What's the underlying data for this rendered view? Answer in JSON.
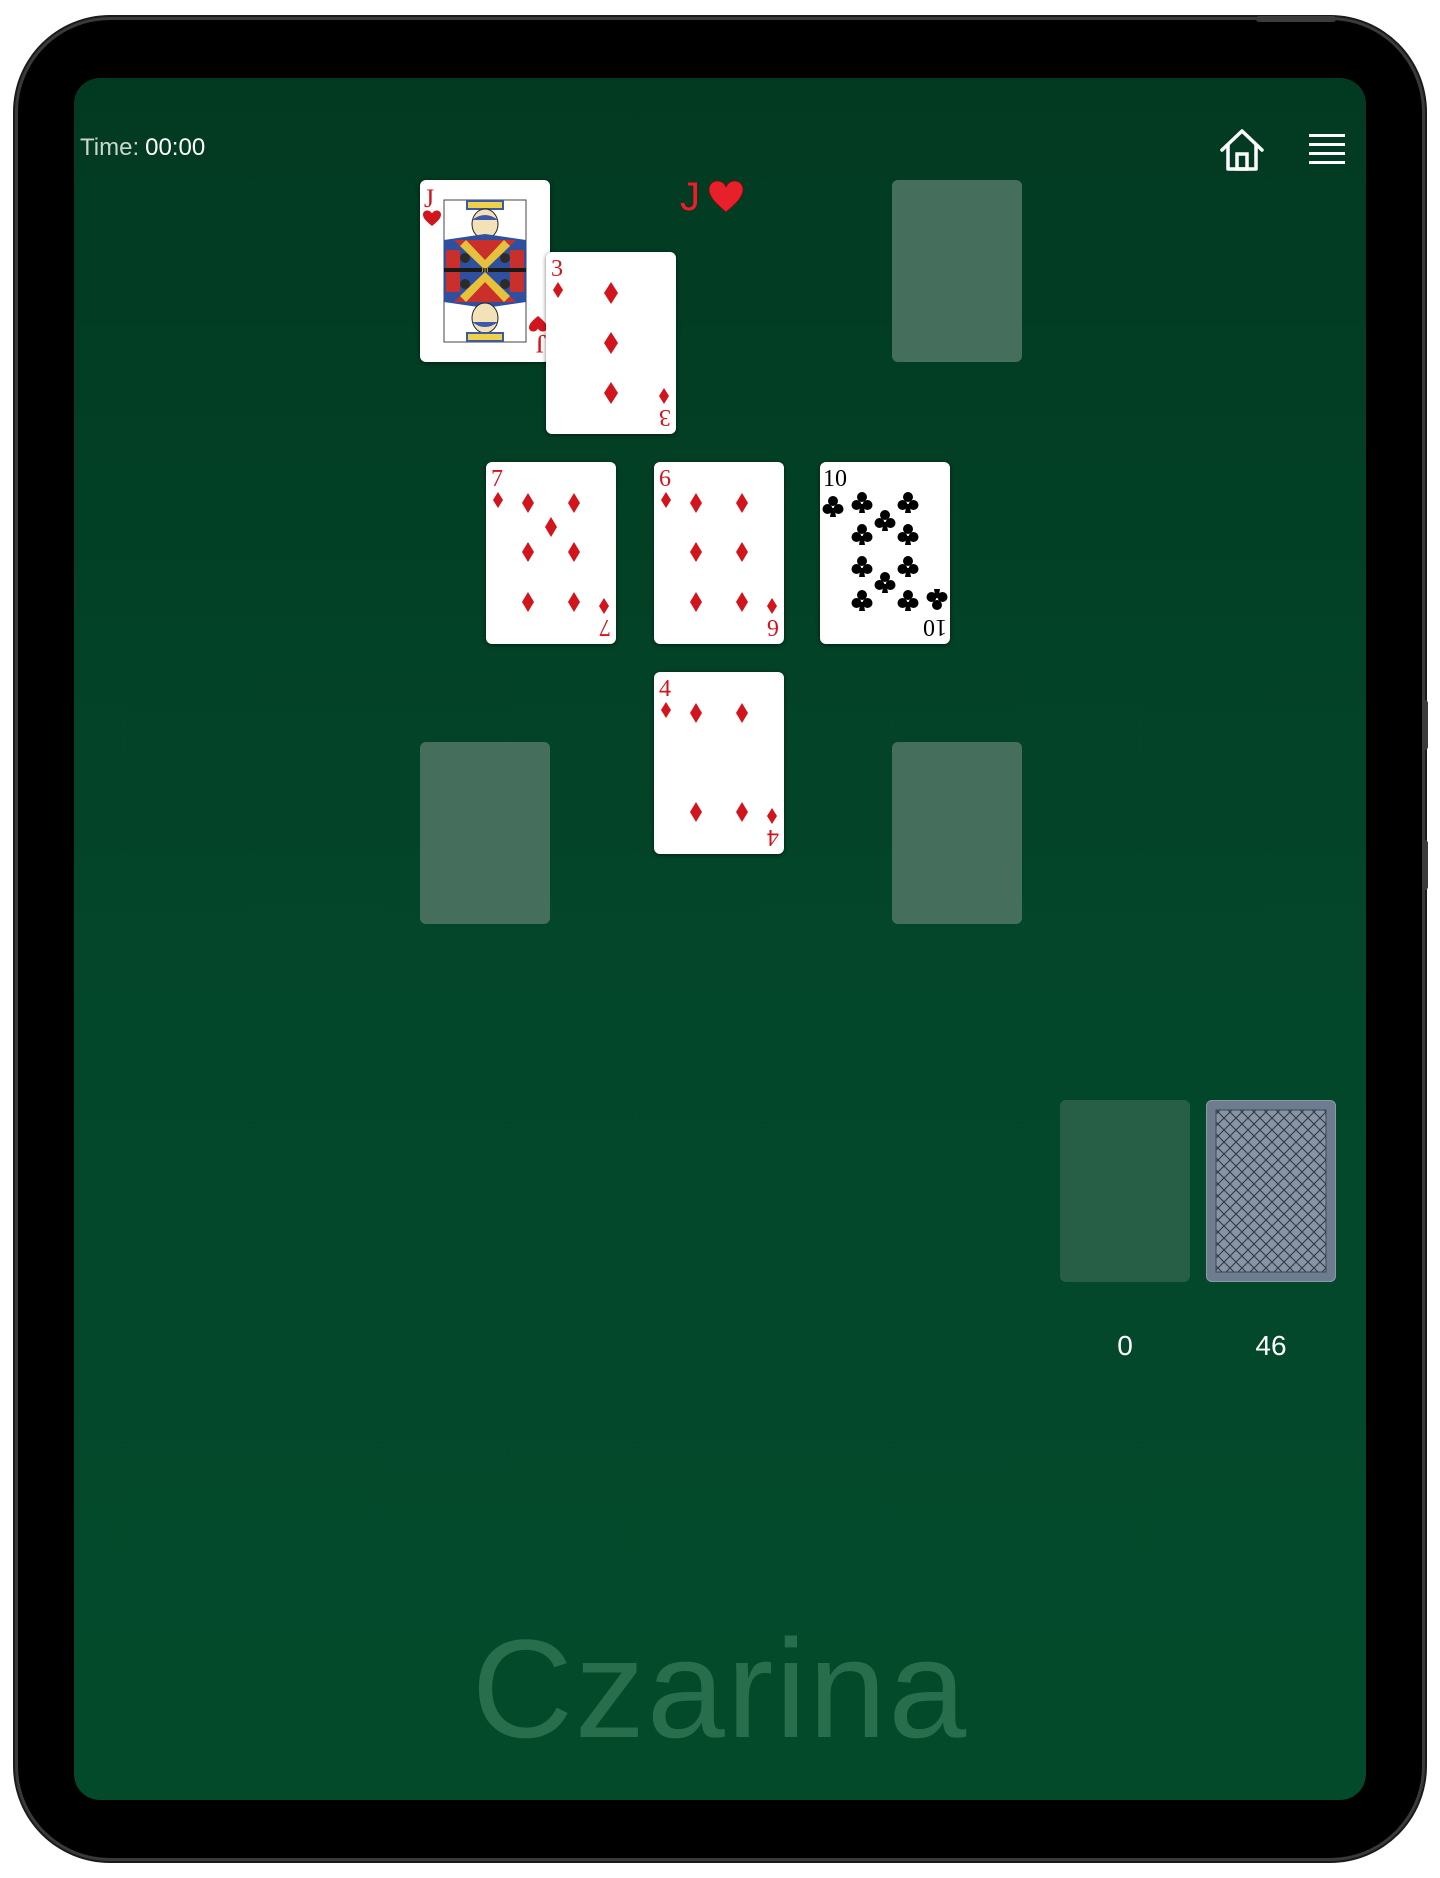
{
  "header": {
    "time_label": "Time:",
    "time_value": "00:00",
    "home_icon": "home-icon",
    "menu_icon": "hamburger-menu-icon"
  },
  "target": {
    "rank": "J",
    "suit": "heart"
  },
  "tableau": {
    "top_left_card": {
      "rank": "J",
      "suit": "hearts",
      "face": "jack-of-hearts"
    },
    "top_center_card": {
      "rank": "3",
      "suit": "diamonds"
    },
    "middle_left_card": {
      "rank": "7",
      "suit": "diamonds"
    },
    "middle_center_card": {
      "rank": "6",
      "suit": "diamonds"
    },
    "middle_right_card": {
      "rank": "10",
      "suit": "clubs"
    },
    "bottom_center_card": {
      "rank": "4",
      "suit": "diamonds"
    },
    "empty_slots": 3
  },
  "waste": {
    "count": "0"
  },
  "stock": {
    "count": "46"
  },
  "footer": {
    "game_title": "Czarina"
  },
  "colors": {
    "felt_green": "#03472a",
    "red_suit": "#e8202a",
    "black_suit": "#000000",
    "slot": "#466e5c",
    "card_back": "#6d7d8f"
  }
}
